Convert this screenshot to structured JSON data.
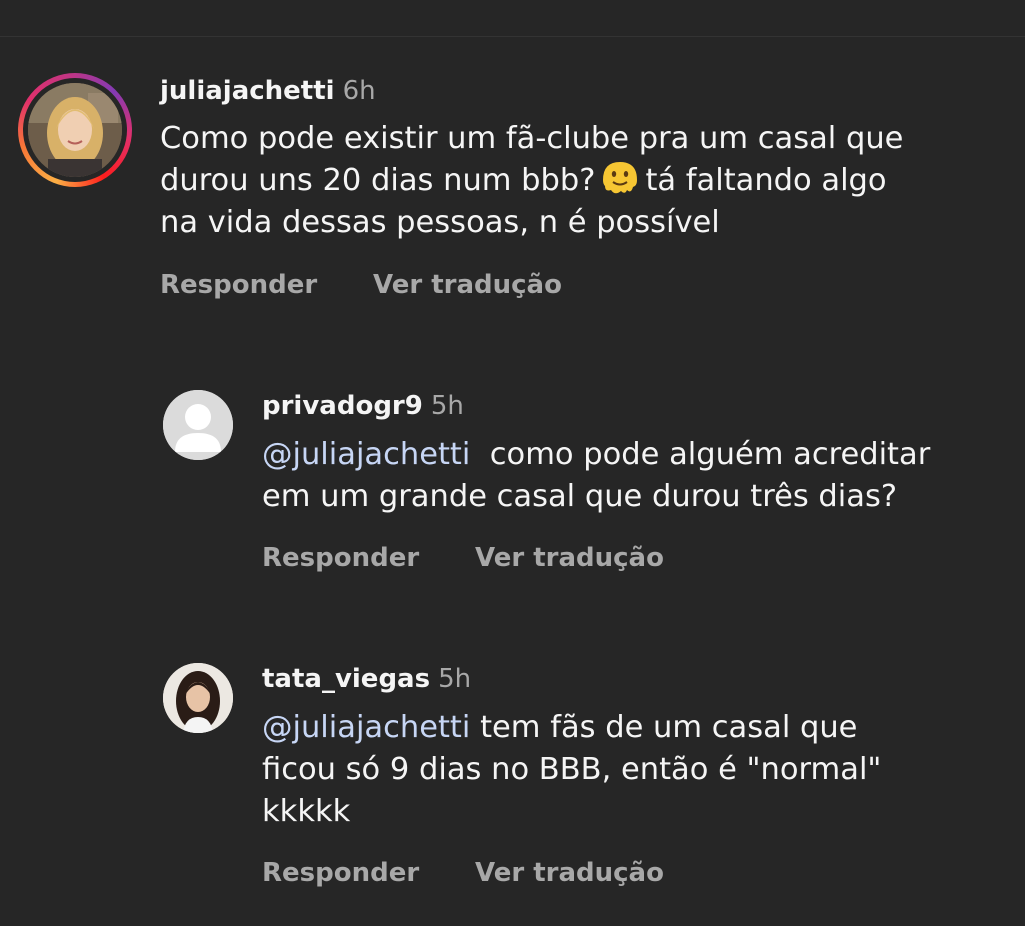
{
  "comments": [
    {
      "username": "juliajachetti",
      "time": "6h",
      "lines": [
        "Como pode existir um fã-clube pra um casal que",
        "durou uns 20 dias num bbb?",
        "tá faltando algo",
        "na vida dessas pessoas, n é possível"
      ],
      "reply_label": "Responder",
      "translate_label": "Ver tradução"
    },
    {
      "username": "privadogr9",
      "time": "5h",
      "mention": "@juliajachetti",
      "lines": [
        "como pode alguém acreditar",
        "em um grande casal que durou três dias?"
      ],
      "reply_label": "Responder",
      "translate_label": "Ver tradução"
    },
    {
      "username": "tata_viegas",
      "time": "5h",
      "mention": "@juliajachetti",
      "lines": [
        "tem fãs de um casal que",
        "ficou só 9 dias no BBB, então é \"normal\"",
        "kkkkk"
      ],
      "reply_label": "Responder",
      "translate_label": "Ver tradução"
    }
  ],
  "icons": {
    "melting_face": "melting-face-emoji",
    "default_avatar": "default-user-avatar"
  },
  "colors": {
    "background": "#262626",
    "text": "#f5f5f5",
    "secondary": "#a8a8a8",
    "mention": "#c7d6f5"
  }
}
